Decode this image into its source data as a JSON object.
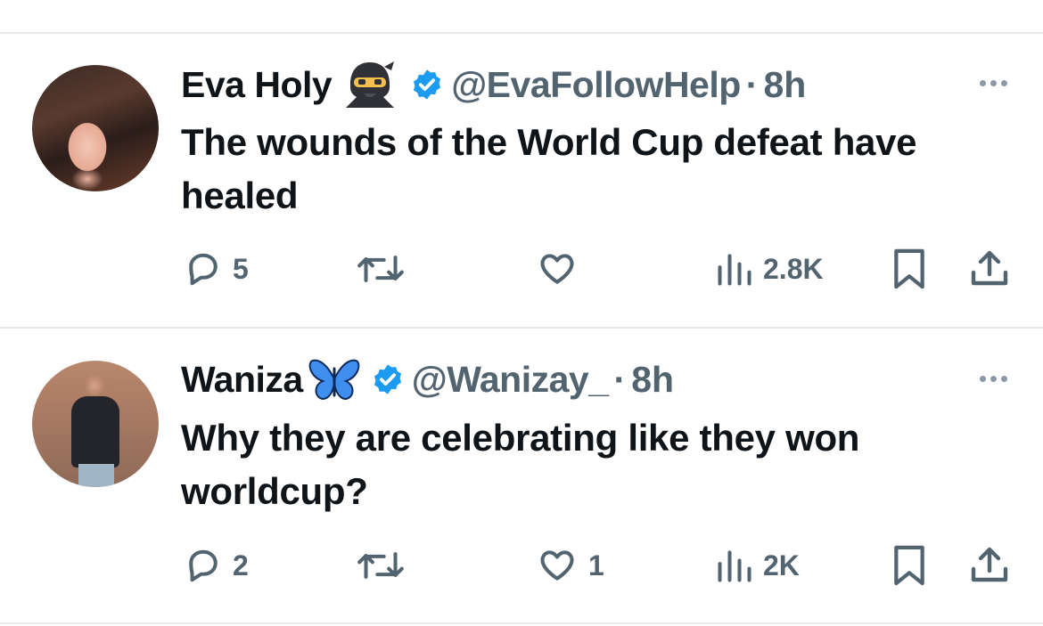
{
  "tweets": [
    {
      "name": "Eva Holy",
      "name_emoji": "ninja-emoji",
      "handle": "@EvaFollowHelp",
      "separator": "·",
      "time": "8h",
      "text": "The wounds of the World Cup defeat have healed",
      "replies": "5",
      "retweets": "",
      "likes": "",
      "views": "2.8K"
    },
    {
      "name": "Waniza",
      "name_emoji": "blue-butterfly-emoji",
      "handle": "@Wanizay_",
      "separator": "·",
      "time": "8h",
      "text": "Why they are celebrating like they won worldcup?",
      "replies": "2",
      "retweets": "",
      "likes": "1",
      "views": "2K"
    }
  ],
  "colors": {
    "text": "#0f1419",
    "secondary": "#536471",
    "verified": "#1d9bf0",
    "divider": "#e6e9eb"
  }
}
